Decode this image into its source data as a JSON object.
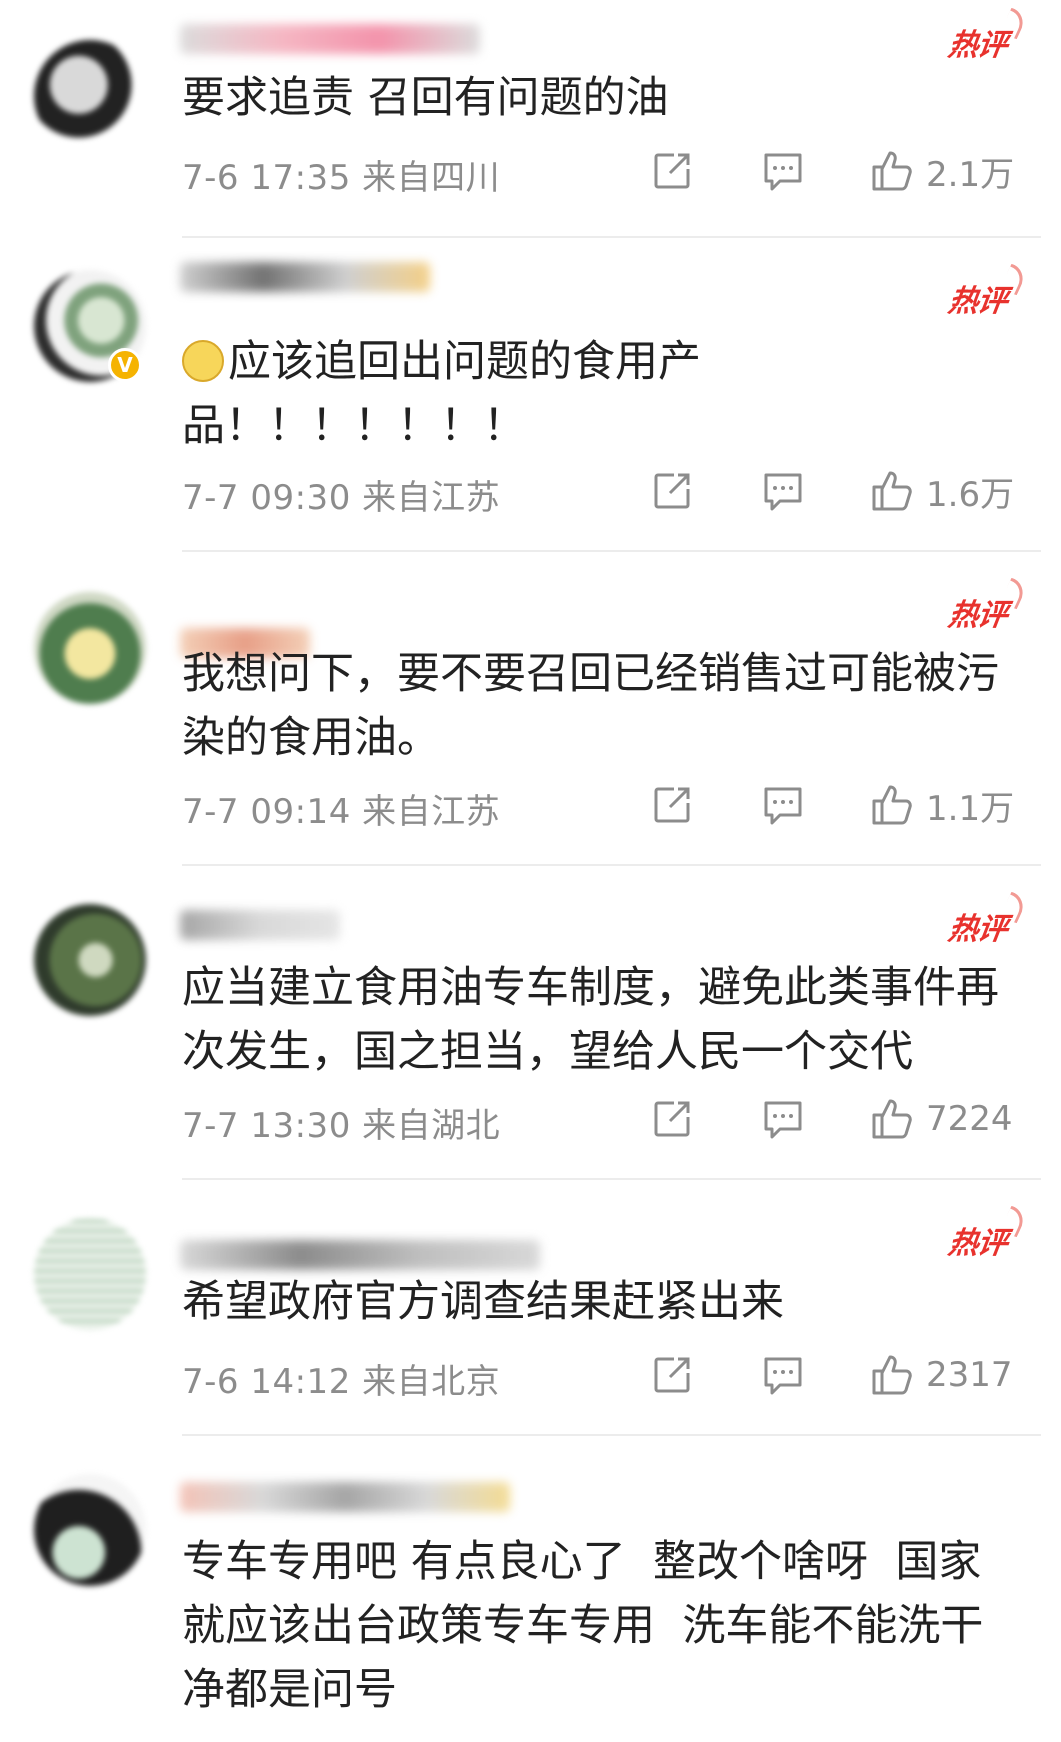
{
  "badges": {
    "hot": "热评"
  },
  "comments": [
    {
      "text": "要求追责 召回有问题的油",
      "time": "7-6 17:35",
      "location": "来自四川",
      "likes": "2.1万"
    },
    {
      "text": "应该追回出问题的食用产\n品！！！！！！！",
      "time": "7-7 09:30",
      "location": "来自江苏",
      "likes": "1.6万",
      "emoji": "sweat-smile-emoji",
      "verified": true
    },
    {
      "text": "我想问下，要不要召回已经销售过可能被污\n染的食用油。",
      "time": "7-7 09:14",
      "location": "来自江苏",
      "likes": "1.1万"
    },
    {
      "text": "应当建立食用油专车制度，避免此类事件再\n次发生，国之担当，望给人民一个交代",
      "time": "7-7 13:30",
      "location": "来自湖北",
      "likes": "7224"
    },
    {
      "text": "希望政府官方调查结果赶紧出来",
      "time": "7-6 14:12",
      "location": "来自北京",
      "likes": "2317"
    },
    {
      "text": "专车专用吧 有点良心了  整改个啥呀  国家\n就应该出台政策专车专用  洗车能不能洗干\n净都是问号"
    }
  ],
  "icons": {
    "share": "share-icon",
    "reply": "comment-icon",
    "like": "thumbs-up-icon"
  },
  "colors": {
    "hot": "#e8322d",
    "meta": "#8c8c8c",
    "text": "#222222"
  }
}
